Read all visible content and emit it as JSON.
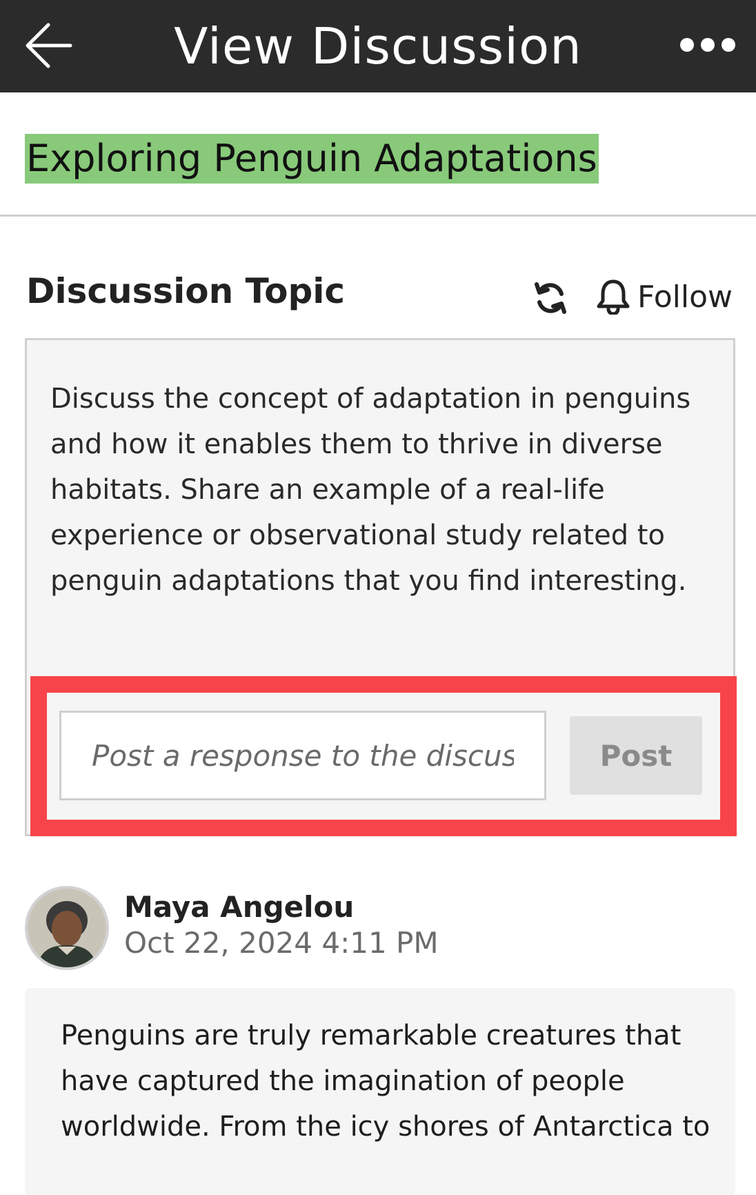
{
  "header": {
    "title": "View Discussion",
    "back_icon": "arrow-left-icon",
    "menu_icon": "more-horizontal-icon"
  },
  "course": {
    "title": "Exploring Penguin Adaptations",
    "highlight_color": "#88c97a"
  },
  "topic": {
    "heading": "Discussion Topic",
    "refresh_icon": "refresh-icon",
    "follow_label": "Follow",
    "follow_icon": "bell-icon",
    "body": "Discuss the concept of adaptation in penguins and how it enables them to thrive in diverse habitats. Share an example of a real-life experience or observational study related to penguin adaptations that you find interesting."
  },
  "response": {
    "placeholder": "Post a response to the discussion",
    "value": "",
    "post_label": "Post",
    "highlight_color": "#f7444a"
  },
  "post": {
    "author": "Maya Angelou",
    "date": "Oct 22, 2024 4:11 PM",
    "body": "Penguins are truly remarkable creatures that have captured the imagination of people worldwide. From the icy shores of Antarctica to"
  }
}
